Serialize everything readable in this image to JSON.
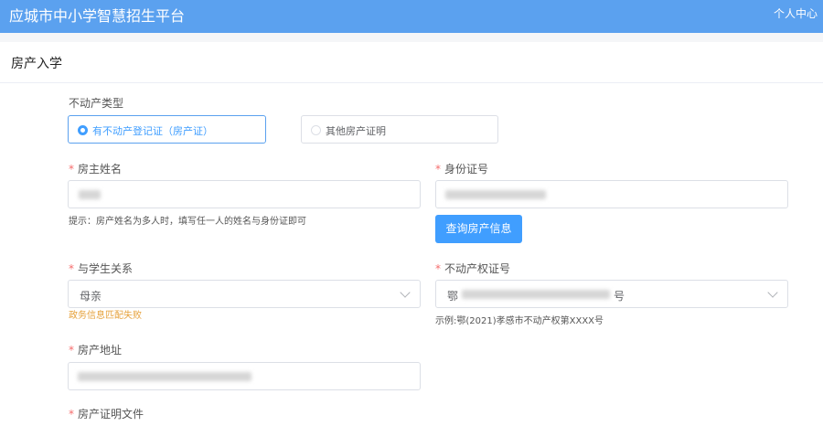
{
  "header": {
    "title": "应城市中小学智慧招生平台",
    "user_center": "个人中心"
  },
  "page": {
    "section_title": "房产入学"
  },
  "property_type": {
    "label": "不动产类型",
    "options": [
      {
        "label": "有不动产登记证（房产证）",
        "selected": true
      },
      {
        "label": "其他房产证明",
        "selected": false
      }
    ]
  },
  "owner_name": {
    "label": "房主姓名",
    "required_mark": "*",
    "hint": "提示：房产姓名为多人时，填写任一人的姓名与身份证即可"
  },
  "id_number": {
    "label": "身份证号",
    "required_mark": "*",
    "query_button": "查询房产信息"
  },
  "relation": {
    "label": "与学生关系",
    "required_mark": "*",
    "value": "母亲",
    "error": "政务信息匹配失败"
  },
  "property_cert": {
    "label": "不动产权证号",
    "required_mark": "*",
    "value_prefix": "鄂",
    "value_suffix": "号",
    "example": "示例:鄂(2021)孝感市不动产权第XXXX号"
  },
  "address": {
    "label": "房产地址",
    "required_mark": "*"
  },
  "proof_file": {
    "label": "房产证明文件",
    "required_mark": "*"
  },
  "colors": {
    "header_bg": "#5ba1ef",
    "primary": "#409eff",
    "required": "#f56c6c",
    "warning": "#e6a23c"
  }
}
